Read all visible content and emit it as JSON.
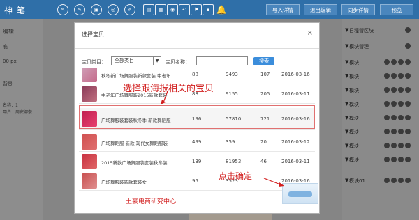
{
  "app": {
    "brand": "神笔"
  },
  "toolbar": {
    "tools": [
      {
        "icon": "text-icon",
        "glyph": "✎"
      },
      {
        "icon": "edit-icon",
        "glyph": "✎"
      },
      {
        "icon": "image-icon",
        "glyph": "▣"
      },
      {
        "icon": "product-icon",
        "glyph": "◎"
      },
      {
        "icon": "pen-icon",
        "glyph": "✐"
      },
      {
        "icon": "copy-icon",
        "glyph": "▤"
      },
      {
        "icon": "grid-icon",
        "glyph": "▦"
      },
      {
        "icon": "circle-icon",
        "glyph": "◉"
      },
      {
        "icon": "undo-icon",
        "glyph": "↶"
      },
      {
        "icon": "flag-icon",
        "glyph": "⚑"
      },
      {
        "icon": "save-icon",
        "glyph": "▪"
      },
      {
        "icon": "bell-icon",
        "glyph": "🔔"
      }
    ],
    "buttons": [
      "导入详情",
      "退出编辑",
      "同步详情",
      "预览"
    ]
  },
  "left_panel": {
    "title": "编辑",
    "label1": "底",
    "field": "00 px",
    "label2": "背景",
    "label3": "名称：1",
    "label4": "用户：周安娜奈"
  },
  "right_panel": {
    "section1": "日程管区块",
    "section2": "模块管理",
    "row_label": "模块",
    "last_row_label": "模块01"
  },
  "modal": {
    "title": "选择宝贝",
    "close": "×",
    "category_label": "宝贝类目：",
    "category_value": "全部类目",
    "name_label": "宝贝名称：",
    "name_value": "",
    "search_label": "搜索",
    "rows": [
      {
        "title": "秋冬新广场舞服装新款套装 中老年",
        "a": "88",
        "b": "9493",
        "c": "107",
        "date": "2016-03-16",
        "colors": [
          "#d0a0b8",
          "#c56a8a"
        ]
      },
      {
        "title": "中老年广场舞服装2015新款套装",
        "a": "88",
        "b": "9155",
        "c": "205",
        "date": "2016-03-11",
        "colors": [
          "#8a3a58",
          "#c07080"
        ]
      },
      {
        "title": "广场舞服装套装秋冬季 新款舞蹈服",
        "a": "196",
        "b": "57810",
        "c": "721",
        "date": "2016-03-16",
        "colors": [
          "#c02050",
          "#e84070"
        ]
      },
      {
        "title": "广场舞蹈服 新款 现代女舞蹈服装",
        "a": "499",
        "b": "359",
        "c": "20",
        "date": "2016-03-12",
        "colors": [
          "#d05050",
          "#e07070"
        ]
      },
      {
        "title": "2015新款广场舞服装套装秋冬装",
        "a": "139",
        "b": "81953",
        "c": "46",
        "date": "2016-03-11",
        "colors": [
          "#c83040",
          "#e06868"
        ]
      },
      {
        "title": "广场舞服装新款套装女",
        "a": "95",
        "b": "3523",
        "c": "",
        "date": "2016-03-16",
        "colors": [
          "#c85050",
          "#e09090"
        ]
      }
    ]
  },
  "annotations": {
    "select_hint": "选择跟海报相关的宝贝",
    "confirm_hint": "点击确定",
    "watermark": "土豪电商研究中心"
  }
}
